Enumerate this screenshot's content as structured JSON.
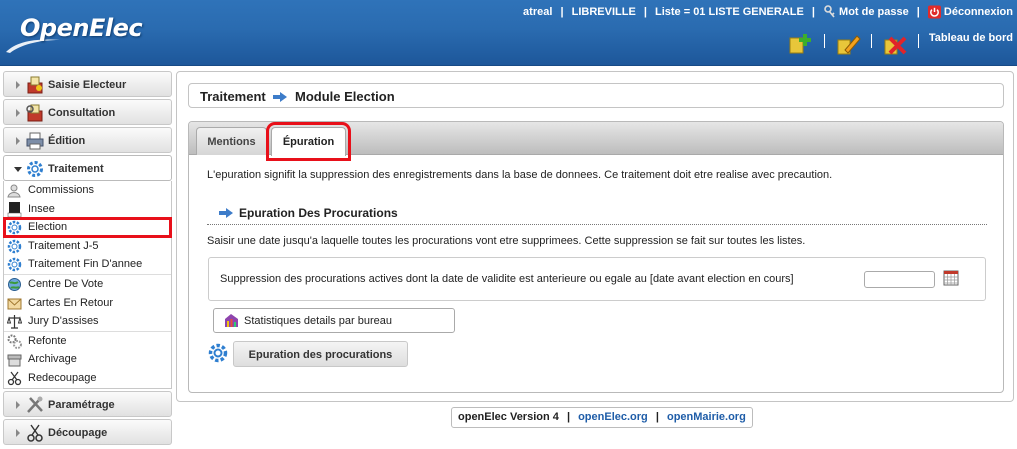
{
  "header": {
    "logo_text": "OpenElec",
    "user": "atreal",
    "city": "LIBREVILLE",
    "liste": "Liste = 01 LISTE GENERALE",
    "password_label": "Mot de passe",
    "logout_label": "Déconnexion",
    "dashboard_label": "Tableau de bord",
    "tools": [
      {
        "name": "add",
        "icon": "add-plus-icon"
      },
      {
        "name": "edit",
        "icon": "pencil-icon"
      },
      {
        "name": "delete",
        "icon": "delete-x-icon"
      }
    ]
  },
  "sidebar": {
    "menus_top": [
      {
        "label": "Saisie Electeur",
        "icon": "ballot-box-icon"
      },
      {
        "label": "Consultation",
        "icon": "ballot-box-icon"
      },
      {
        "label": "Édition",
        "icon": "printer-icon"
      }
    ],
    "active_menu": {
      "label": "Traitement",
      "icon": "gear-icon"
    },
    "groups": [
      [
        {
          "label": "Commissions",
          "icon": "users-icon"
        },
        {
          "label": "Insee",
          "icon": "insee-icon"
        },
        {
          "label": "Election",
          "icon": "gear-icon",
          "selected": true
        },
        {
          "label": "Traitement J-5",
          "icon": "gear-icon"
        },
        {
          "label": "Traitement Fin D'annee",
          "icon": "gear-icon"
        }
      ],
      [
        {
          "label": "Centre De Vote",
          "icon": "globe-icon"
        },
        {
          "label": "Cartes En Retour",
          "icon": "envelope-icon"
        },
        {
          "label": "Jury D'assises",
          "icon": "scales-icon"
        }
      ],
      [
        {
          "label": "Refonte",
          "icon": "gears-icon"
        },
        {
          "label": "Archivage",
          "icon": "archive-icon"
        },
        {
          "label": "Redecoupage",
          "icon": "scissors-icon"
        }
      ]
    ],
    "menus_bottom": [
      {
        "label": "Paramétrage",
        "icon": "tools-icon"
      },
      {
        "label": "Découpage",
        "icon": "scissors-icon"
      }
    ]
  },
  "main": {
    "breadcrumb": {
      "part1": "Traitement",
      "part2": "Module Election"
    },
    "tabs": [
      {
        "label": "Mentions",
        "active": false
      },
      {
        "label": "Épuration",
        "active": true
      }
    ],
    "intro": "L'epuration signifit la suppression des enregistrements dans la base de donnees. Ce traitement doit etre realise avec precaution.",
    "section_title": "Epuration Des Procurations",
    "description": "Saisir une date jusqu'a laquelle toutes les procurations vont etre supprimees. Cette suppression se fait sur toutes les listes.",
    "date_label": "Suppression des procurations actives dont la date de validite est anterieure ou egale au [date avant election en cours]",
    "date_value": "",
    "stats_button": "Statistiques details par bureau",
    "submit_button": "Epuration des procurations"
  },
  "footer": {
    "version": "openElec Version 4",
    "link1": "openElec.org",
    "link2": "openMairie.org"
  },
  "colors": {
    "header_blue": "#2a6bb0",
    "highlight_red": "#e8101a",
    "link_blue": "#1f5da8"
  }
}
